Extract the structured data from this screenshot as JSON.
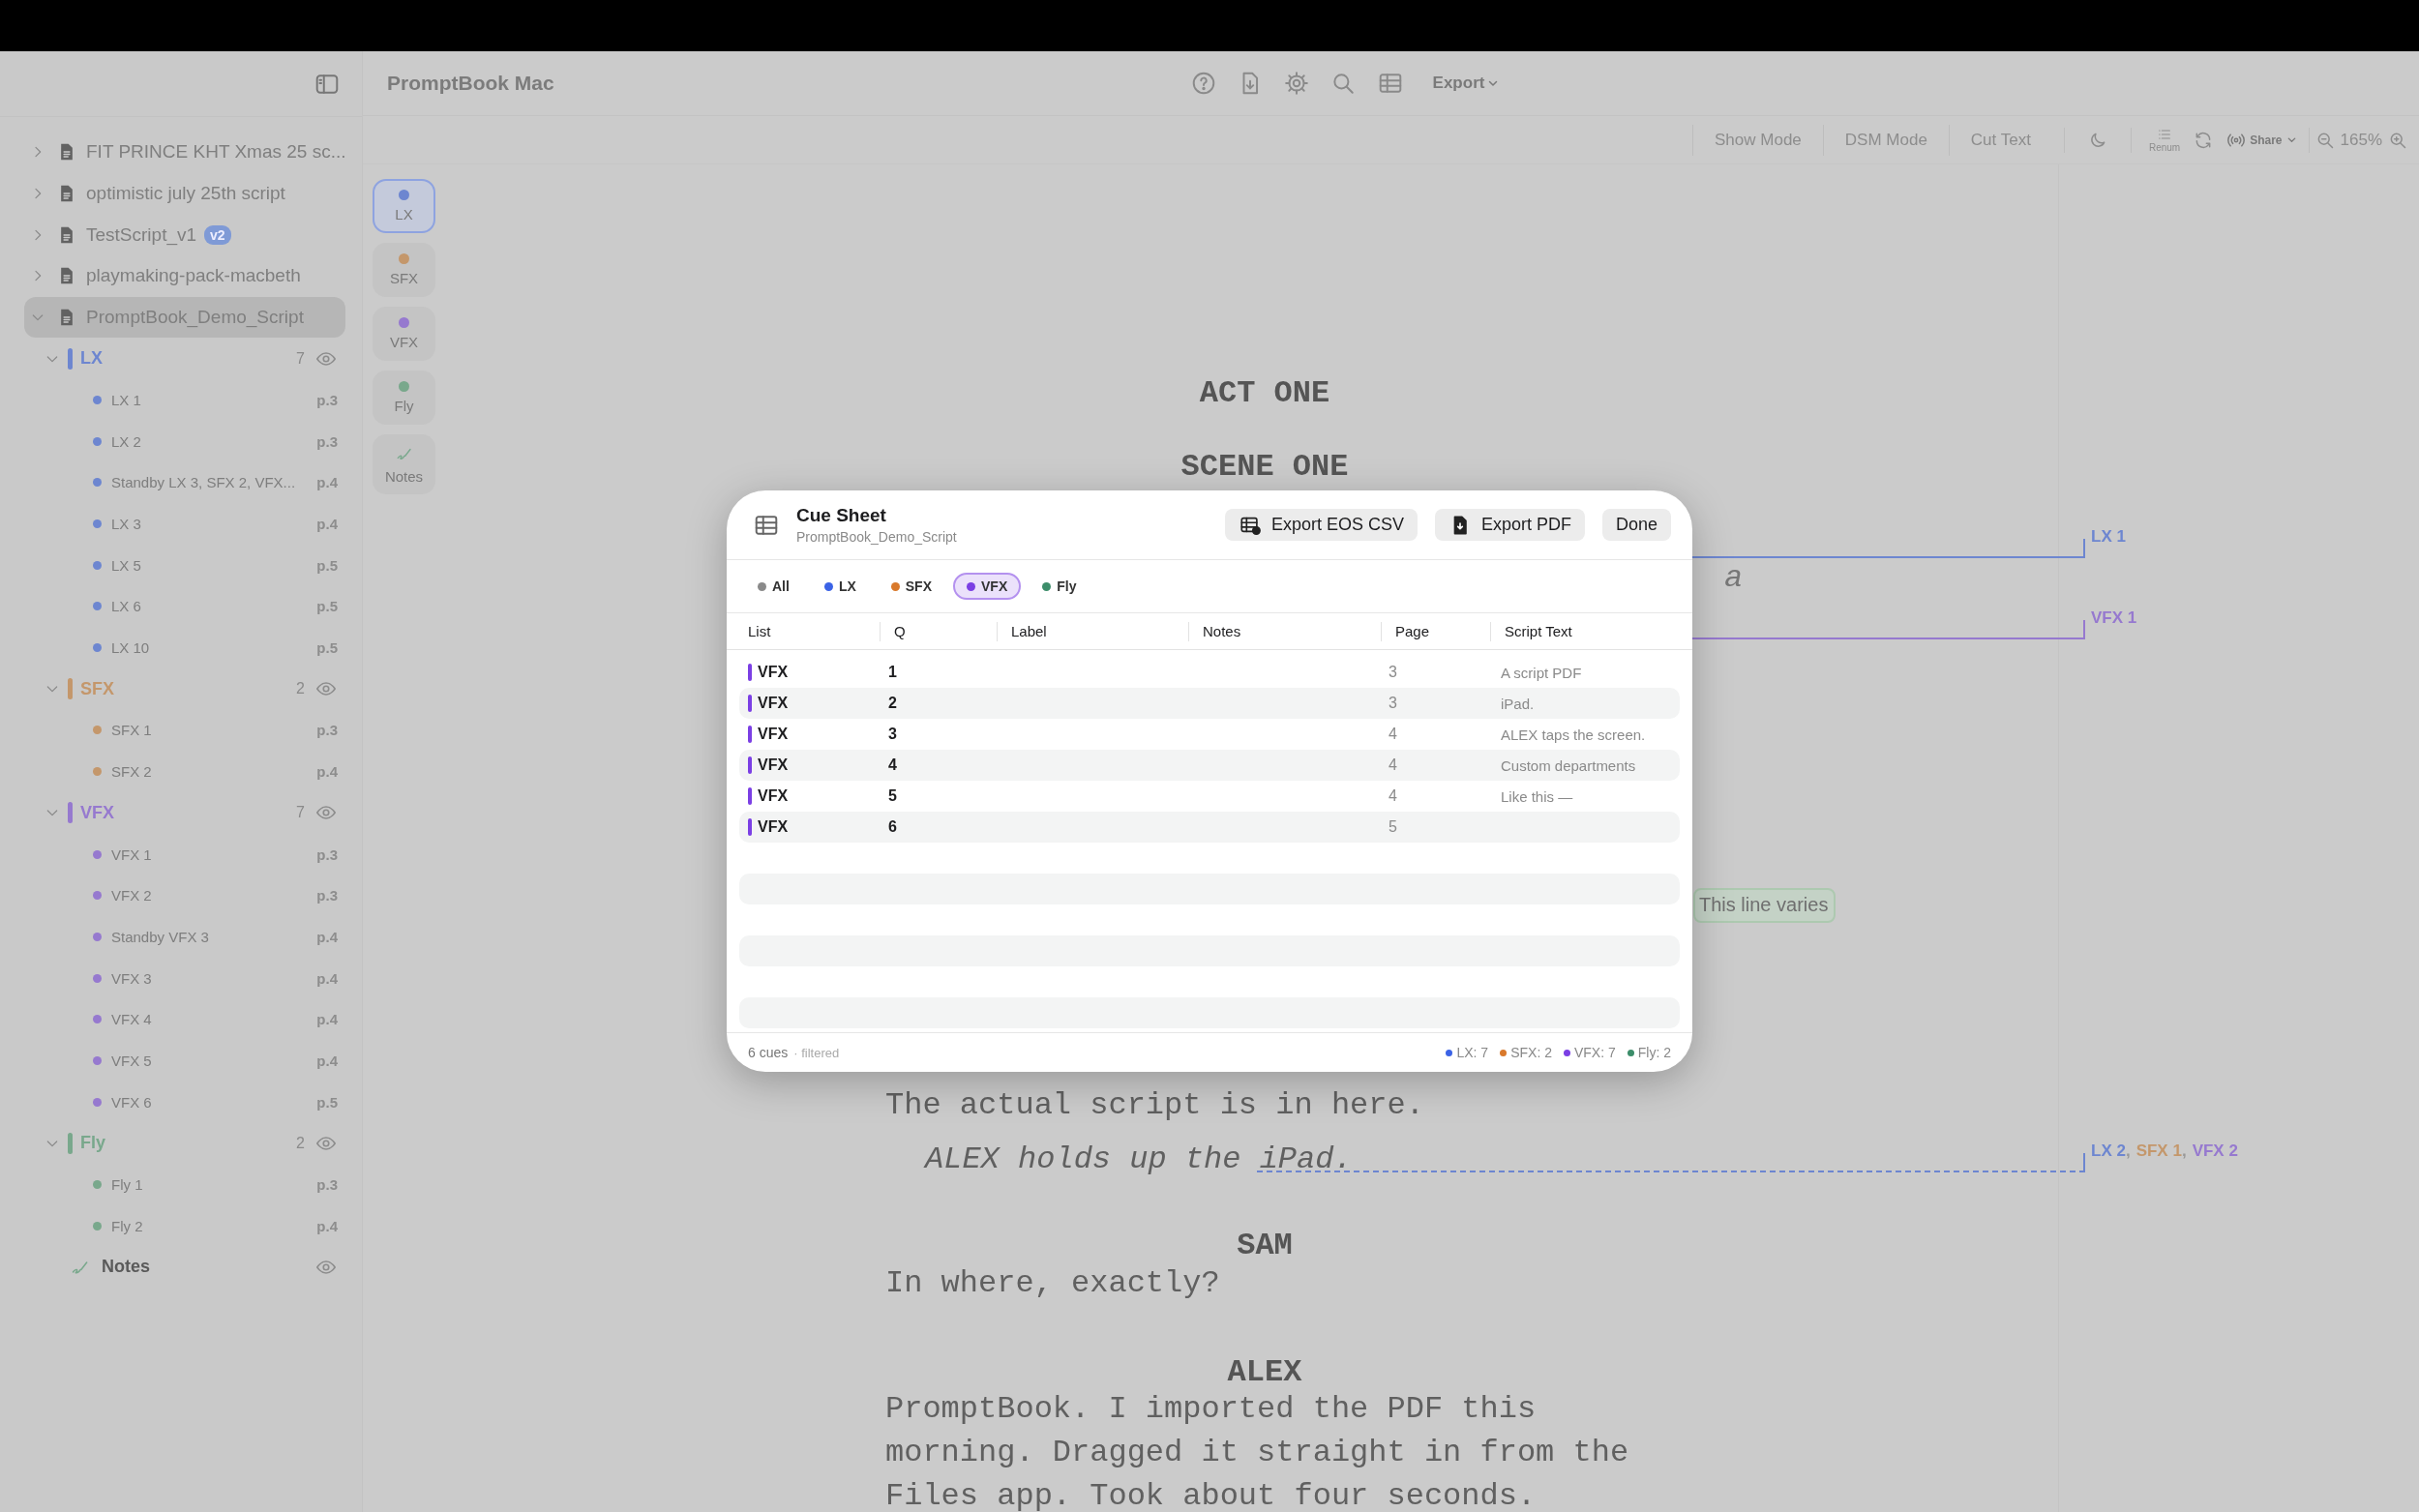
{
  "sidebar": {
    "documents": [
      {
        "name": "FIT PRINCE KHT Xmas 25 sc...",
        "expanded": false,
        "selected": false
      },
      {
        "name": "optimistic july 25th script",
        "expanded": false,
        "selected": false
      },
      {
        "name": "TestScript_v1",
        "badge": "v2",
        "expanded": false,
        "selected": false
      },
      {
        "name": "playmaking-pack-macbeth",
        "expanded": false,
        "selected": false
      },
      {
        "name": "PromptBook_Demo_Script",
        "expanded": true,
        "selected": true,
        "children": [
          {
            "kind": "list",
            "name": "LX",
            "count": "7",
            "color": "#6d86d0",
            "expanded": true,
            "children": [
              {
                "name": "LX 1",
                "page": "p.3"
              },
              {
                "name": "LX 2",
                "page": "p.3"
              },
              {
                "name": "Standby LX 3, SFX 2, VFX...",
                "page": "p.4"
              },
              {
                "name": "LX 3",
                "page": "p.4"
              },
              {
                "name": "LX 5",
                "page": "p.5"
              },
              {
                "name": "LX 6",
                "page": "p.5"
              },
              {
                "name": "LX 10",
                "page": "p.5"
              }
            ]
          },
          {
            "kind": "list",
            "name": "SFX",
            "count": "2",
            "color": "#c4976b",
            "expanded": true,
            "children": [
              {
                "name": "SFX 1",
                "page": "p.3"
              },
              {
                "name": "SFX 2",
                "page": "p.4"
              }
            ]
          },
          {
            "kind": "list",
            "name": "VFX",
            "count": "7",
            "color": "#9679cf",
            "expanded": true,
            "children": [
              {
                "name": "VFX 1",
                "page": "p.3"
              },
              {
                "name": "VFX 2",
                "page": "p.3"
              },
              {
                "name": "Standby VFX 3",
                "page": "p.4"
              },
              {
                "name": "VFX 3",
                "page": "p.4"
              },
              {
                "name": "VFX 4",
                "page": "p.4"
              },
              {
                "name": "VFX 5",
                "page": "p.4"
              },
              {
                "name": "VFX 6",
                "page": "p.5"
              }
            ]
          },
          {
            "kind": "list",
            "name": "Fly",
            "count": "2",
            "color": "#79a88c",
            "expanded": true,
            "children": [
              {
                "name": "Fly 1",
                "page": "p.3"
              },
              {
                "name": "Fly 2",
                "page": "p.4"
              }
            ]
          },
          {
            "kind": "notes",
            "name": "Notes"
          }
        ]
      }
    ]
  },
  "toolbar": {
    "title": "PromptBook Mac",
    "export_menu": "Export",
    "mode_buttons": [
      "Show Mode",
      "DSM Mode",
      "Cut Text"
    ],
    "renum": "Renum",
    "share": "Share",
    "zoom": "165%"
  },
  "rail": [
    {
      "kind": "list",
      "label": "LX",
      "color": "#6d86d0",
      "selected": true
    },
    {
      "kind": "list",
      "label": "SFX",
      "color": "#c4976b",
      "selected": false
    },
    {
      "kind": "list",
      "label": "VFX",
      "color": "#9679cf",
      "selected": false
    },
    {
      "kind": "list",
      "label": "Fly",
      "color": "#79a88c",
      "selected": false
    },
    {
      "kind": "notes",
      "label": "Notes",
      "selected": false
    }
  ],
  "script": {
    "lines": [
      {
        "kind": "heading",
        "text": "ACT ONE"
      },
      {
        "kind": "heading",
        "text": "SCENE ONE"
      },
      {
        "kind": "dialogue",
        "text": "The actual script is in here."
      },
      {
        "kind": "action",
        "text": "ALEX holds up the iPad."
      },
      {
        "kind": "character",
        "text": "SAM"
      },
      {
        "kind": "dialogue",
        "text": "In where, exactly?"
      },
      {
        "kind": "character",
        "text": "ALEX"
      },
      {
        "kind": "dialogue",
        "text": "PromptBook. I imported the PDF this morning. Dragged it straight in from the Files app. Took about four seconds."
      }
    ],
    "fragment": "a",
    "note_tag": "This line varies",
    "cue_marks": [
      {
        "labels": [
          {
            "text": "LX 1",
            "color": "#6d86d0"
          }
        ]
      },
      {
        "labels": [
          {
            "text": "VFX 1",
            "color": "#9679cf"
          }
        ]
      },
      {
        "separator": ",",
        "labels": [
          {
            "text": "LX 2",
            "color": "#6d86d0"
          },
          {
            "text": "SFX 1",
            "color": "#c4976b"
          },
          {
            "text": "VFX 2",
            "color": "#9679cf"
          }
        ]
      }
    ]
  },
  "cue_sheet": {
    "title": "Cue Sheet",
    "subtitle": "PromptBook_Demo_Script",
    "buttons": [
      "Export EOS CSV",
      "Export PDF",
      "Done"
    ],
    "filters": [
      {
        "label": "All",
        "color": "#8a8a8a",
        "selected": false
      },
      {
        "label": "LX",
        "color": "#3b63e6",
        "selected": false
      },
      {
        "label": "SFX",
        "color": "#d9792b",
        "selected": false
      },
      {
        "label": "VFX",
        "color": "#7b3fe4",
        "selected": true
      },
      {
        "label": "Fly",
        "color": "#3c8d6a",
        "selected": false
      }
    ],
    "columns": [
      "List",
      "Q",
      "Label",
      "Notes",
      "Page",
      "Script Text"
    ],
    "rows": [
      {
        "list": "VFX",
        "q": "1",
        "page": "3",
        "script_text": "A script PDF"
      },
      {
        "list": "VFX",
        "q": "2",
        "page": "3",
        "script_text": "iPad."
      },
      {
        "list": "VFX",
        "q": "3",
        "page": "4",
        "script_text": "ALEX taps the screen."
      },
      {
        "list": "VFX",
        "q": "4",
        "page": "4",
        "script_text": "Custom departments"
      },
      {
        "list": "VFX",
        "q": "5",
        "page": "4",
        "script_text": "Like this —"
      },
      {
        "list": "VFX",
        "q": "6",
        "page": "5"
      }
    ],
    "footer": {
      "count": "6 cues",
      "note": "· filtered",
      "totals": [
        {
          "label": "LX: 7",
          "color": "#3b63e6"
        },
        {
          "label": "SFX: 2",
          "color": "#d9792b"
        },
        {
          "label": "VFX: 7",
          "color": "#7b3fe4"
        },
        {
          "label": "Fly: 2",
          "color": "#3c8d6a"
        }
      ]
    }
  }
}
